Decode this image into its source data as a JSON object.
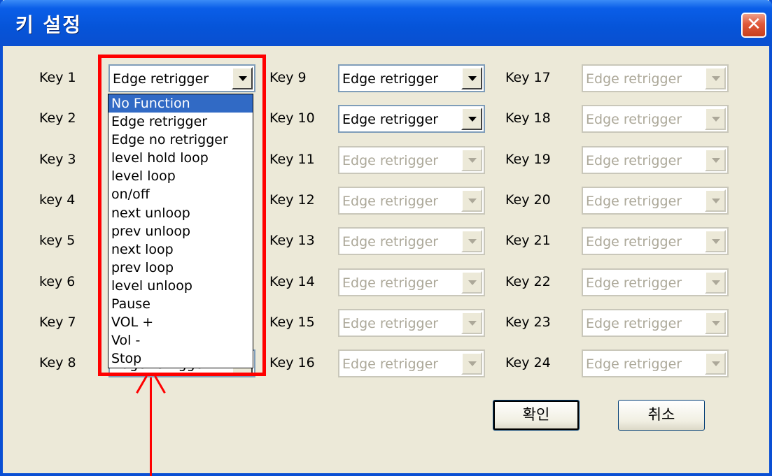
{
  "window": {
    "title": "키 설정",
    "close_glyph": "✕"
  },
  "keys": [
    {
      "label": "Key 1",
      "value": "Edge retrigger",
      "enabled": true
    },
    {
      "label": "Key 2",
      "value": "",
      "enabled": true
    },
    {
      "label": "Key 3",
      "value": "",
      "enabled": true
    },
    {
      "label": "key 4",
      "value": "",
      "enabled": true
    },
    {
      "label": "key 5",
      "value": "",
      "enabled": true
    },
    {
      "label": "key 6",
      "value": "",
      "enabled": true
    },
    {
      "label": "Key 7",
      "value": "",
      "enabled": true
    },
    {
      "label": "Key 8",
      "value": "Edge retrigger",
      "enabled": true
    },
    {
      "label": "Key 9",
      "value": "Edge retrigger",
      "enabled": true
    },
    {
      "label": "Key 10",
      "value": "Edge retrigger",
      "enabled": true
    },
    {
      "label": "Key 11",
      "value": "Edge retrigger",
      "enabled": false
    },
    {
      "label": "Key 12",
      "value": "Edge retrigger",
      "enabled": false
    },
    {
      "label": "Key 13",
      "value": "Edge retrigger",
      "enabled": false
    },
    {
      "label": "Key 14",
      "value": "Edge retrigger",
      "enabled": false
    },
    {
      "label": "Key 15",
      "value": "Edge retrigger",
      "enabled": false
    },
    {
      "label": "Key 16",
      "value": "Edge retrigger",
      "enabled": false
    },
    {
      "label": "Key 17",
      "value": "Edge retrigger",
      "enabled": false
    },
    {
      "label": "Key 18",
      "value": "Edge retrigger",
      "enabled": false
    },
    {
      "label": "Key 19",
      "value": "Edge retrigger",
      "enabled": false
    },
    {
      "label": "Key 20",
      "value": "Edge retrigger",
      "enabled": false
    },
    {
      "label": "Key 21",
      "value": "Edge retrigger",
      "enabled": false
    },
    {
      "label": "Key 22",
      "value": "Edge retrigger",
      "enabled": false
    },
    {
      "label": "Key 23",
      "value": "Edge retrigger",
      "enabled": false
    },
    {
      "label": "Key 24",
      "value": "Edge retrigger",
      "enabled": false
    }
  ],
  "dropdown": {
    "selected": "No Function",
    "options": [
      "No Function",
      "Edge retrigger",
      "Edge no retrigger",
      "level hold loop",
      "level loop",
      "on/off",
      "next unloop",
      "prev unloop",
      "next loop",
      "prev loop",
      "level unloop",
      "Pause",
      "VOL +",
      "Vol -",
      "Stop"
    ]
  },
  "buttons": {
    "ok": "확인",
    "cancel": "취소"
  },
  "colors": {
    "title_bar": "#0654d8",
    "dialog_bg": "#ece9d8",
    "selection": "#316ac5",
    "highlight": "#ff0000"
  }
}
